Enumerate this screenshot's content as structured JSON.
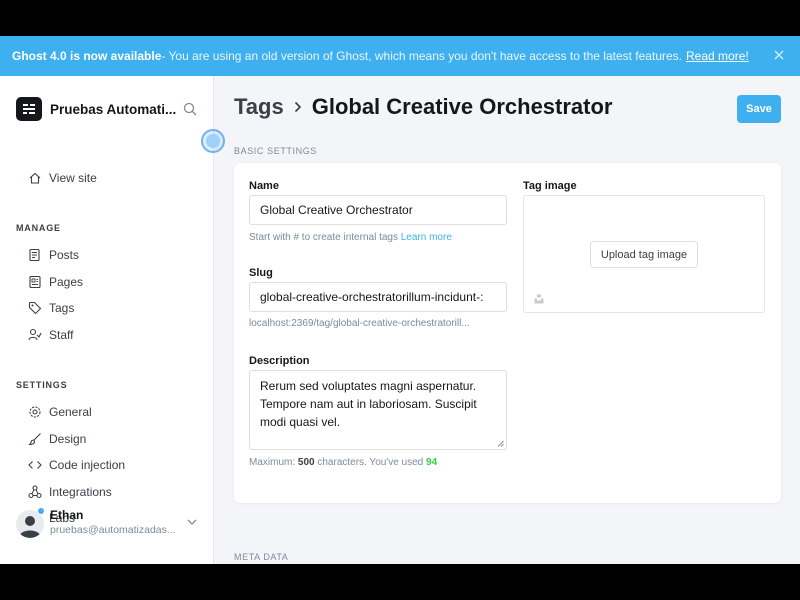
{
  "banner": {
    "bold": "Ghost 4.0 is now available",
    "text": " - You are using an old version of Ghost, which means you don't have access to the latest features.",
    "link": "Read more!"
  },
  "sidebar": {
    "site_name": "Pruebas Automati...",
    "view_site": "View site",
    "manage_label": "MANAGE",
    "manage_items": [
      "Posts",
      "Pages",
      "Tags",
      "Staff"
    ],
    "settings_label": "SETTINGS",
    "settings_items": [
      "General",
      "Design",
      "Code injection",
      "Integrations",
      "Labs"
    ],
    "user": {
      "name": "Ethan",
      "email": "pruebas@automatizadas..."
    }
  },
  "header": {
    "crumb": "Tags",
    "title": "Global Creative Orchestrator",
    "save_label": "Save"
  },
  "form": {
    "section_label": "BASIC SETTINGS",
    "name_label": "Name",
    "name_value": "Global Creative Orchestrator",
    "name_hint": "Start with # to create internal tags",
    "name_hint_link": "Learn more",
    "slug_label": "Slug",
    "slug_value": "global-creative-orchestratorillum-incidunt-:",
    "slug_hint": "localhost:2369/tag/global-creative-orchestratorill...",
    "description_label": "Description",
    "description_value": "Rerum sed voluptates magni aspernatur. Tempore nam aut in laboriosam. Suscipit modi quasi vel.",
    "desc_hint_prefix": "Maximum:",
    "desc_hint_max": "500",
    "desc_hint_middle": "characters. You've used",
    "desc_hint_used": "94",
    "tag_image_label": "Tag image",
    "upload_label": "Upload tag image"
  },
  "meta_label": "META DATA",
  "colors": {
    "accent": "#3eb0ef",
    "used_count": "#30cf43",
    "sidebar_bg": "#ffffff",
    "page_bg": "#f4f5f8"
  }
}
